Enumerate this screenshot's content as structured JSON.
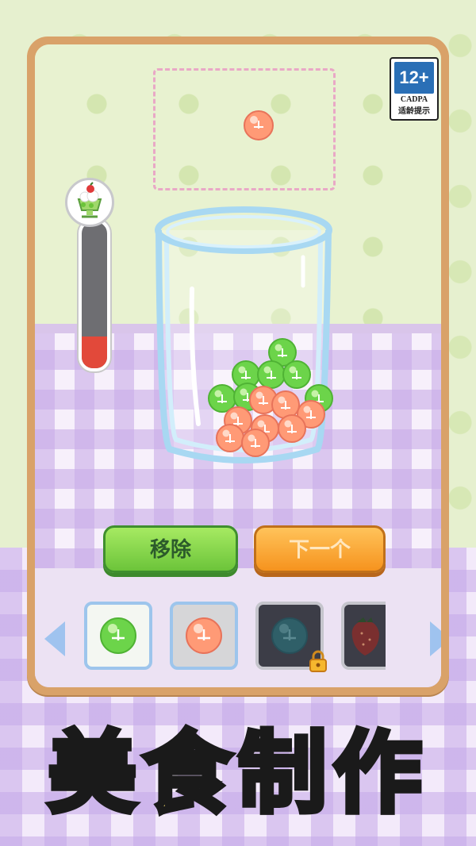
{
  "age_rating": {
    "age": "12+",
    "org": "CADPA",
    "hint": "适龄提示"
  },
  "progress": {
    "level_fraction": 0.22,
    "fill_color": "#e2493a",
    "icon": "melon-parfait-icon"
  },
  "glass": {
    "green_balls": 7,
    "orange_balls": 8
  },
  "buttons": {
    "remove_label": "移除",
    "next_label": "下一个"
  },
  "items": [
    {
      "name": "green-boba",
      "color": "#6cd44a",
      "locked": false,
      "selected": true
    },
    {
      "name": "orange-boba",
      "color": "#ff9a76",
      "locked": false,
      "selected": false
    },
    {
      "name": "teal-boba",
      "color": "#3a7d86",
      "locked": true,
      "selected": false
    },
    {
      "name": "strawberry",
      "color": "#c7403c",
      "locked": true,
      "selected": false
    }
  ],
  "title": {
    "c1": "美",
    "c2": "食",
    "c3": "制",
    "c4": "作"
  }
}
